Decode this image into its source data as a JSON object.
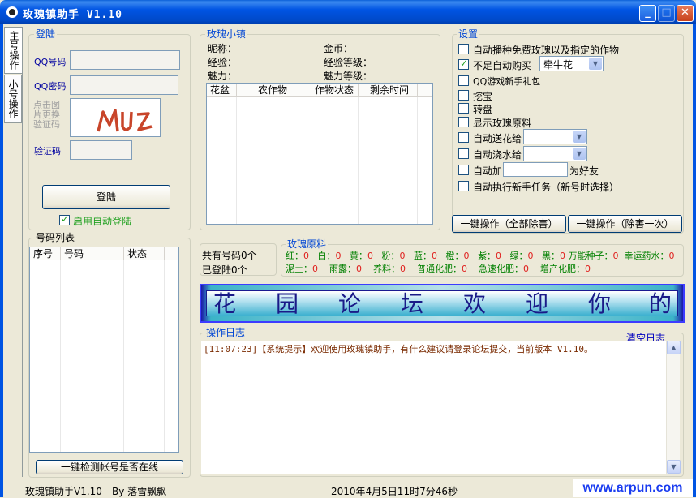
{
  "window": {
    "title": "玫瑰镇助手 V1.10",
    "minimize": "_",
    "maximize": "□",
    "close": "✕"
  },
  "tabs": [
    {
      "label": "主号操作"
    },
    {
      "label": "小号操作"
    }
  ],
  "login": {
    "group_label": "登陆",
    "qq_label": "QQ号码",
    "password_label": "QQ密码",
    "refresh_label": "点击图片更换验证码",
    "captcha_text": "MUZ",
    "verify_label": "验证码",
    "login_button": "登陆",
    "auto_login_label": "启用自动登陆",
    "auto_login_checked": true
  },
  "account_list": {
    "group_label": "号码列表",
    "columns": [
      "序号",
      "号码",
      "状态"
    ],
    "check_button": "一键检测帐号是否在线"
  },
  "town": {
    "group_label": "玫瑰小镇",
    "nickname_label": "昵称：",
    "gold_label": "金币：",
    "exp_label": "经验：",
    "exp_level_label": "经验等级：",
    "charm_label": "魅力：",
    "charm_level_label": "魅力等级：",
    "columns": [
      "花盆",
      "农作物",
      "作物状态",
      "剩余时间"
    ]
  },
  "settings": {
    "group_label": "设置",
    "items": [
      {
        "label": "自动播种免费玫瑰以及指定的作物",
        "checked": false
      },
      {
        "label": "不足自动购买",
        "checked": true,
        "select": "牵牛花"
      },
      {
        "label": "QQ游戏新手礼包",
        "checked": false
      },
      {
        "label": "挖宝",
        "checked": false
      },
      {
        "label": "转盘",
        "checked": false
      },
      {
        "label": "显示玫瑰原料",
        "checked": false
      },
      {
        "label": "自动送花给",
        "checked": false,
        "select": ""
      },
      {
        "label": "自动浇水给",
        "checked": false,
        "select": ""
      },
      {
        "label": "自动加",
        "checked": false,
        "suffix": "为好友"
      },
      {
        "label": "自动执行新手任务（新号时选择）",
        "checked": false
      }
    ],
    "button_all": "一键操作（全部除害）",
    "button_once": "一键操作（除害一次）"
  },
  "counts": {
    "total_label": "共有号码0个",
    "logged_label": "已登陆0个"
  },
  "materials": {
    "group_label": "玫瑰原料",
    "row1": [
      {
        "name": "红：",
        "value": "0"
      },
      {
        "name": "白：",
        "value": "0"
      },
      {
        "name": "黄：",
        "value": "0"
      },
      {
        "name": "粉：",
        "value": "0"
      },
      {
        "name": "蓝：",
        "value": "0"
      },
      {
        "name": "橙：",
        "value": "0"
      },
      {
        "name": "紫：",
        "value": "0"
      },
      {
        "name": "绿：",
        "value": "0"
      },
      {
        "name": "黑：",
        "value": "0"
      },
      {
        "name": "万能种子：",
        "value": "0"
      },
      {
        "name": "幸运药水：",
        "value": "0"
      }
    ],
    "row2": [
      {
        "name": "泥土：",
        "value": "0"
      },
      {
        "name": "雨露：",
        "value": "0"
      },
      {
        "name": "养料：",
        "value": "0"
      },
      {
        "name": "普通化肥：",
        "value": "0"
      },
      {
        "name": "急速化肥：",
        "value": "0"
      },
      {
        "name": "增产化肥：",
        "value": "0"
      }
    ]
  },
  "banner": {
    "chars": [
      "花",
      "园",
      "论",
      "坛",
      "欢",
      "迎",
      "你",
      "的"
    ]
  },
  "log": {
    "group_label": "操作日志",
    "clear_label": "清空日志",
    "entries": [
      "[11:07:23]【系统提示】欢迎使用玫瑰镇助手，有什么建议请登录论坛提交，当前版本 V1.10。"
    ]
  },
  "statusbar": {
    "app": "玫瑰镇助手V1.10",
    "author": "By  落雪飘飘",
    "time": "2010年4月5日11时7分46秒"
  },
  "watermark": "www.arpun.com",
  "colors": {
    "titlebar": "#0054e3",
    "face": "#ece9d8",
    "group_label": "#0046d5",
    "value_red": "#e0201e",
    "accent_green": "#008000"
  }
}
